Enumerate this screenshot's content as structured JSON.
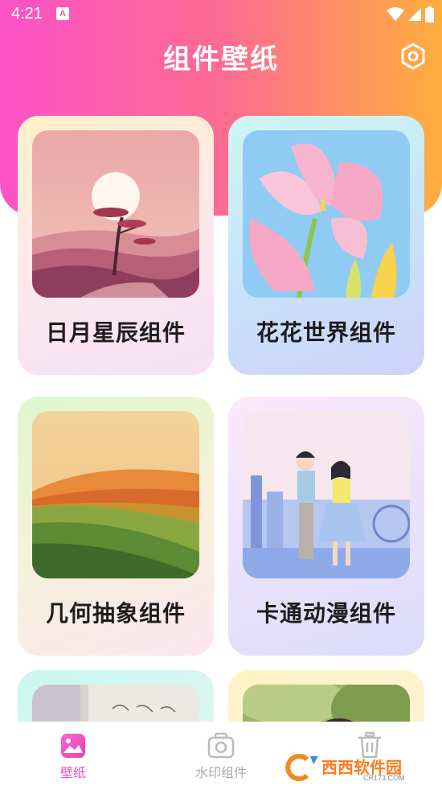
{
  "status_bar": {
    "time": "4:21",
    "notification_letter": "A"
  },
  "app": {
    "title": "组件壁纸"
  },
  "cards": [
    {
      "label": "日月星辰组件",
      "image": "sunset-tree-landscape"
    },
    {
      "label": "花花世界组件",
      "image": "pink-tulip-flower"
    },
    {
      "label": "几何抽象组件",
      "image": "abstract-rolling-hills"
    },
    {
      "label": "卡通动漫组件",
      "image": "anime-couple-illustration"
    },
    {
      "label": "",
      "image": "salad-notebook-photo"
    },
    {
      "label": "",
      "image": "girl-portrait-green-photo"
    }
  ],
  "bottom_nav": {
    "items": [
      {
        "label": "壁纸",
        "icon": "image-icon",
        "active": true
      },
      {
        "label": "水印组件",
        "icon": "camera-icon",
        "active": false
      },
      {
        "label": "",
        "icon": "trash-icon",
        "active": false
      }
    ]
  },
  "watermark": {
    "brand": "西西软件园",
    "url": "CR173.COM"
  },
  "colors": {
    "accent": "#f34fbe",
    "gradient_start": "#fb52c6",
    "gradient_end": "#ffae3d"
  }
}
